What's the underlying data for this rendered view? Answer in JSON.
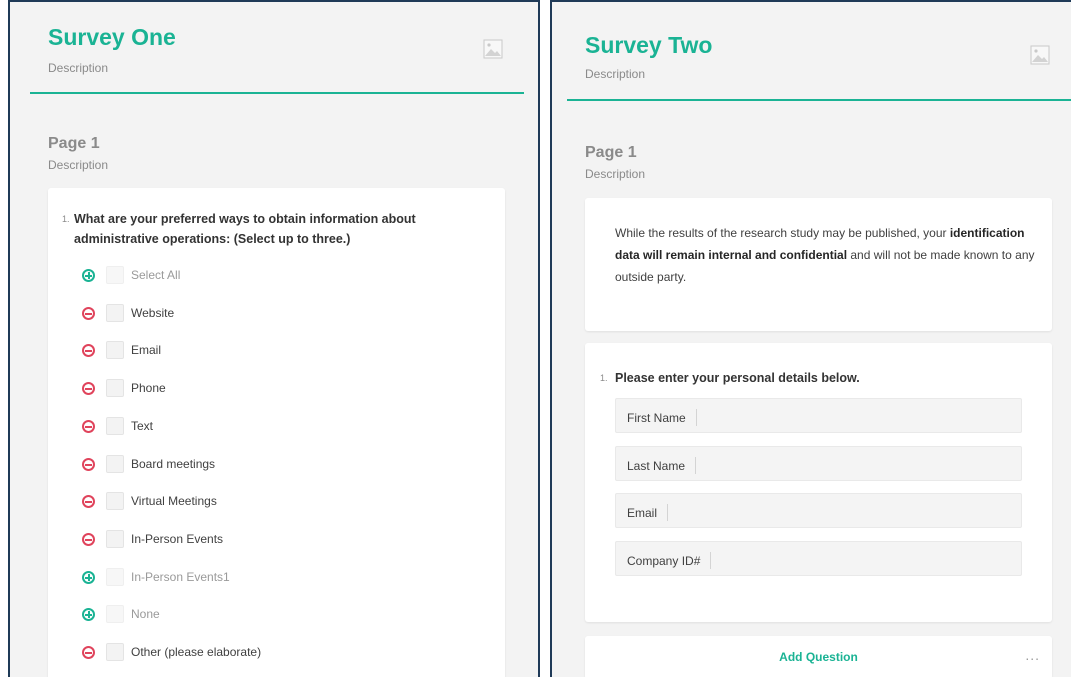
{
  "survey_one": {
    "title": "Survey One",
    "description": "Description",
    "image_icon": "image-placeholder-icon",
    "page": {
      "title": "Page 1",
      "description": "Description"
    },
    "question": {
      "number": "1.",
      "text": "What are your preferred ways to obtain information about administrative operations: (Select up to three.)",
      "choices": [
        {
          "label": "Select All",
          "toggle": "add",
          "muted": true
        },
        {
          "label": "Website",
          "toggle": "remove",
          "muted": false
        },
        {
          "label": "Email",
          "toggle": "remove",
          "muted": false
        },
        {
          "label": "Phone",
          "toggle": "remove",
          "muted": false
        },
        {
          "label": "Text",
          "toggle": "remove",
          "muted": false
        },
        {
          "label": "Board meetings",
          "toggle": "remove",
          "muted": false
        },
        {
          "label": "Virtual Meetings",
          "toggle": "remove",
          "muted": false
        },
        {
          "label": "In-Person Events",
          "toggle": "remove",
          "muted": false
        },
        {
          "label": "In-Person Events1",
          "toggle": "add",
          "muted": true
        },
        {
          "label": "None",
          "toggle": "add",
          "muted": true
        },
        {
          "label": "Other (please elaborate)",
          "toggle": "remove",
          "muted": false
        }
      ]
    }
  },
  "survey_two": {
    "title": "Survey Two",
    "description": "Description",
    "image_icon": "image-placeholder-icon",
    "page": {
      "title": "Page 1",
      "description": "Description"
    },
    "intro": {
      "before": "While the results of the research study may be published, your ",
      "bold": "identification data will remain internal and confidential",
      "after": " and will not be made known to any outside party."
    },
    "question": {
      "number": "1.",
      "text": "Please enter your personal details below.",
      "fields": [
        "First Name",
        "Last Name",
        "Email",
        "Company ID#"
      ]
    },
    "add_question_label": "Add Question",
    "more_label": "..."
  },
  "colors": {
    "accent": "#1ab394",
    "remove": "#e0445c",
    "panel_border": "#1f3a57",
    "panel_bg": "#f3f3f3"
  }
}
